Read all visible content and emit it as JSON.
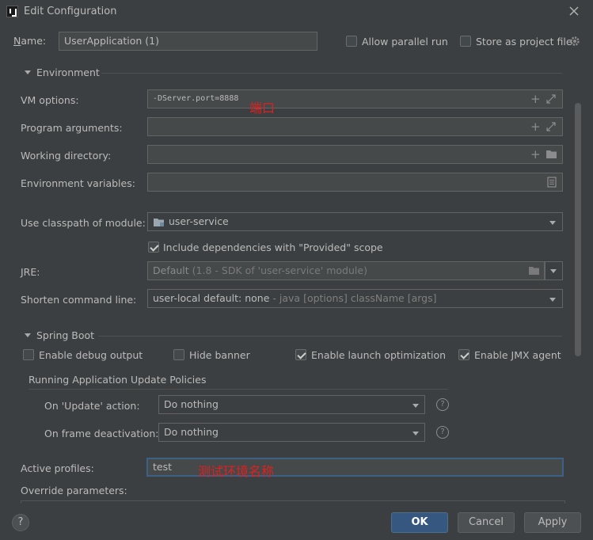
{
  "window": {
    "title": "Edit Configuration"
  },
  "name_row": {
    "label_u": "N",
    "label_rest": "ame:",
    "value": "UserApplication (1)",
    "allow_parallel_run": "Allow parallel run",
    "store_as_project_file": "Store as project file"
  },
  "environment": {
    "header": "Environment",
    "vm_options_label": "VM options:",
    "vm_options_value": "-DServer.port=8888",
    "vm_annotation": "端口",
    "program_arguments_label": "Program arguments:",
    "working_directory_label": "Working directory:",
    "environment_variables_label": "Environment variables:",
    "classpath_label": "Use classpath of module:",
    "classpath_value": "user-service",
    "include_deps": "Include dependencies with \"Provided\" scope",
    "jre_label": "JRE:",
    "jre_value_main": "Default",
    "jre_value_hint": "(1.8 - SDK of 'user-service' module)",
    "shorten_label": "Shorten command line:",
    "shorten_value_main": "user-local default: none",
    "shorten_value_hint": "- java [options] className [args]"
  },
  "spring_boot": {
    "header": "Spring Boot",
    "enable_debug_output": "Enable debug output",
    "hide_banner": "Hide banner",
    "enable_launch_optimization": "Enable launch optimization",
    "enable_jmx_agent": "Enable JMX agent",
    "update_policies_header": "Running Application Update Policies",
    "on_update_label": "On 'Update' action:",
    "on_update_value": "Do nothing",
    "on_frame_label": "On frame deactivation:",
    "on_frame_value": "Do nothing",
    "help": "?"
  },
  "profiles": {
    "active_profiles_label": "Active profiles:",
    "active_profiles_value": "test",
    "profiles_annotation": "测试环境名称",
    "override_parameters_label": "Override parameters:"
  },
  "footer": {
    "help": "?",
    "ok": "OK",
    "cancel": "Cancel",
    "apply": "Apply"
  },
  "colors": {
    "background": "#3c3f41",
    "field": "#45494a",
    "primary_button": "#365880",
    "annotation": "#e02020"
  }
}
